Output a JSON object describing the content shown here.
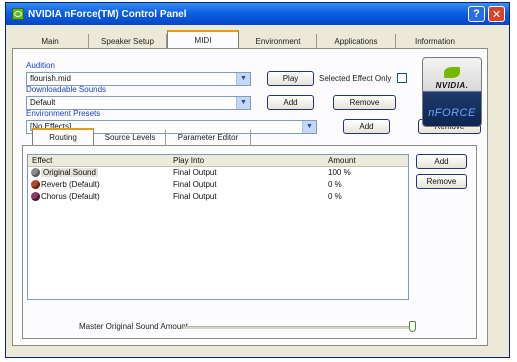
{
  "window": {
    "title": "NVIDIA nForce(TM) Control Panel",
    "help_glyph": "?",
    "close_glyph": "✕"
  },
  "tabs": [
    {
      "label": "Main"
    },
    {
      "label": "Speaker Setup"
    },
    {
      "label": "MIDI",
      "active": true
    },
    {
      "label": "Environment"
    },
    {
      "label": "Applications"
    },
    {
      "label": "Information"
    }
  ],
  "audition": {
    "label": "Audition",
    "value": "flourish.mid",
    "play_label": "Play",
    "selected_effect_only_label": "Selected Effect Only",
    "selected_effect_only_checked": false
  },
  "downloadable_sounds": {
    "label": "Downloadable Sounds",
    "value": "Default",
    "add_label": "Add",
    "remove_label": "Remove"
  },
  "environment_presets": {
    "label": "Environment Presets",
    "value": "[No Effects]",
    "add_label": "Add",
    "remove_label": "Remove"
  },
  "logo": {
    "word": "NVIDIA.",
    "sub": "nFORCE",
    "green": "#76b900"
  },
  "inner_tabs": [
    {
      "label": "Routing",
      "active": true
    },
    {
      "label": "Source Levels"
    },
    {
      "label": "Parameter Editor"
    }
  ],
  "routing_table": {
    "columns": [
      "Effect",
      "Play Into",
      "Amount"
    ],
    "rows": [
      {
        "effect": "Original Sound",
        "play_into": "Final Output",
        "amount": "100 %",
        "icon": "speaker-icon",
        "icon_color": "#8a8a8a"
      },
      {
        "effect": "Reverb (Default)",
        "play_into": "Final Output",
        "amount": "0 %",
        "icon": "reverb-icon",
        "icon_color": "#b5472a"
      },
      {
        "effect": "Chorus (Default)",
        "play_into": "Final Output",
        "amount": "0 %",
        "icon": "chorus-icon",
        "icon_color": "#8e3a6d"
      }
    ],
    "add_label": "Add",
    "remove_label": "Remove"
  },
  "master_slider": {
    "label": "Master Original Sound Amount",
    "value_fraction": 1.0
  },
  "dropdown_glyph": "▼"
}
